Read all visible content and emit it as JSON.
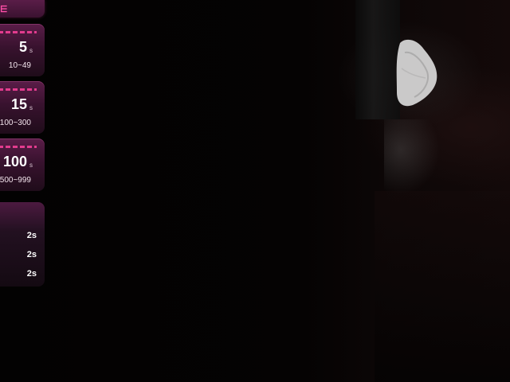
{
  "panel": {
    "tab_icon": "⋿",
    "cards": [
      {
        "count": "5",
        "unit": "s",
        "range": "10~49"
      },
      {
        "count": "15",
        "unit": "s",
        "range": "100~300"
      },
      {
        "count": "100",
        "unit": "s",
        "range": "500~999"
      }
    ],
    "list": [
      {
        "value": "2s"
      },
      {
        "value": "2s"
      },
      {
        "value": "2s"
      }
    ]
  },
  "colors": {
    "accent": "#e23c8e",
    "card_top": "#5a1d48",
    "card_bottom": "#1f0c1a",
    "background": "#000000"
  }
}
